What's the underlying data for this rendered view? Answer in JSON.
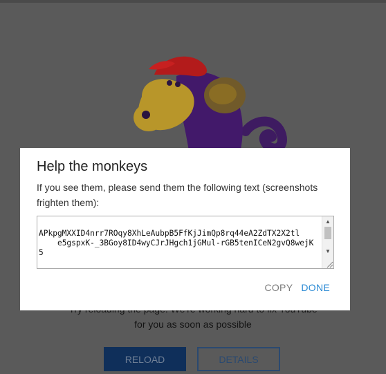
{
  "dialog": {
    "title": "Help the monkeys",
    "instructions": "If you see them, please send them the following text (screenshots frighten them):",
    "code_text": "APkpgMXXID4nrr7ROqy8XhLeAubpB5FfKjJimQp8rq44eA2ZdTX2X2tl\n    e5gspxK-_3BGoy8ID4wyCJrJHgch1jGMul-rGB5tenICeN2gvQ8wejK5",
    "copy_label": "COPY",
    "done_label": "DONE"
  },
  "background": {
    "message_line1": "Try reloading the page. We're working hard to fix YouTube",
    "message_line2": "for you as soon as possible",
    "reload_label": "RELOAD",
    "details_label": "DETAILS"
  },
  "colors": {
    "overlay": "#5a5a5a",
    "accent": "#2a8ad4",
    "reload_bg": "#0f2f5a",
    "monkey_face": "#b8962a",
    "monkey_body": "#42196a",
    "cap": "#b31b1b"
  },
  "icons": [
    "scroll-up-arrow-icon",
    "scroll-down-arrow-icon",
    "resize-grip-icon",
    "monkey-illustration"
  ]
}
